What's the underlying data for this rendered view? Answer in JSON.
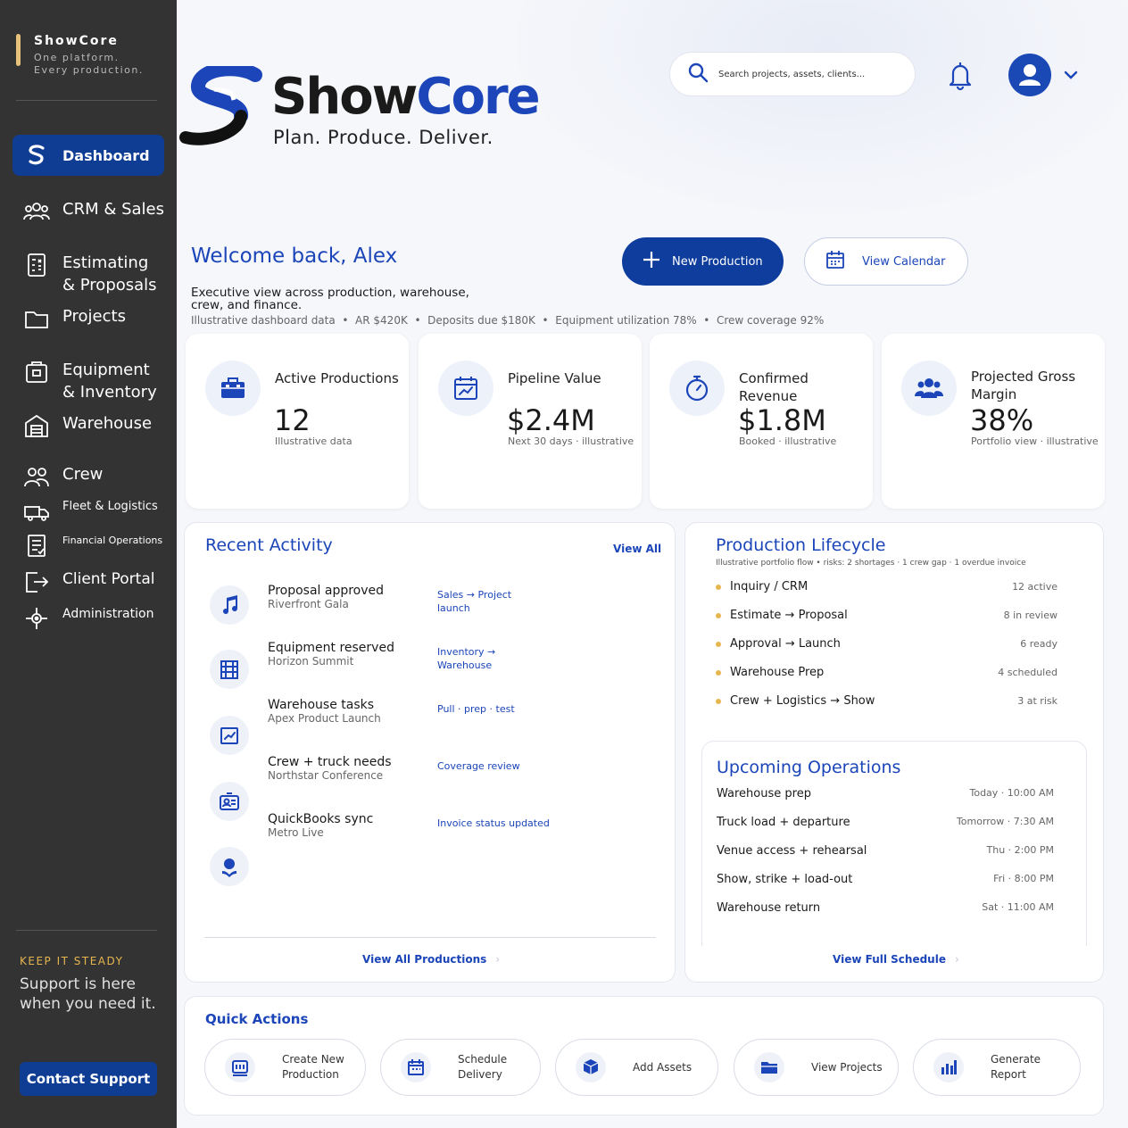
{
  "sidebar": {
    "brand_name": "ShowCore",
    "brand_tagline": "One platform. Every production.",
    "items": [
      {
        "label": "Dashboard",
        "icon": "showcore-logo-icon"
      },
      {
        "label": "CRM & Sales",
        "icon": "people-icon"
      },
      {
        "label": "Estimating & Proposals",
        "icon": "calculator-icon"
      },
      {
        "label": "Projects",
        "icon": "folder-icon"
      },
      {
        "label": "Equipment & Inventory",
        "icon": "case-icon"
      },
      {
        "label": "Warehouse",
        "icon": "warehouse-icon"
      },
      {
        "label": "Crew",
        "icon": "crew-icon"
      },
      {
        "label": "Fleet & Logistics",
        "icon": "truck-icon"
      },
      {
        "label": "Financial Operations",
        "icon": "invoice-icon"
      },
      {
        "label": "Client Portal",
        "icon": "portal-exit-icon"
      },
      {
        "label": "Administration",
        "icon": "admin-target-icon"
      }
    ],
    "keep_title": "KEEP IT STEADY",
    "keep_text": "Support is here when you need it.",
    "support_button": "Contact Support"
  },
  "header": {
    "logo_word_1": "Show",
    "logo_word_2": "Core",
    "logo_tagline": "Plan. Produce. Deliver.",
    "search_placeholder": "Search projects, assets, clients...",
    "welcome": "Welcome back, Alex",
    "subtitle": "Executive view across production, warehouse, crew, and finance.",
    "stats_line": "Illustrative dashboard data  •  AR $420K  •  Deposits due $180K  •  Equipment utilization 78%  •  Crew coverage 92%",
    "new_production": "New Production",
    "view_calendar": "View Calendar"
  },
  "kpis": [
    {
      "title": "Active Productions",
      "value": "12",
      "note": "Illustrative data",
      "icon": "production-case-icon"
    },
    {
      "title": "Pipeline Value",
      "value": "$2.4M",
      "note": "Next 30 days · illustrative",
      "icon": "calendar-chart-icon"
    },
    {
      "title": "Confirmed Revenue",
      "value": "$1.8M",
      "note": "Booked · illustrative",
      "icon": "stopwatch-icon"
    },
    {
      "title": "Projected Gross Margin",
      "value": "38%",
      "note": "Portfolio view · illustrative",
      "icon": "group-icon"
    }
  ],
  "activity": {
    "title": "Recent Activity",
    "view_all": "View All",
    "items": [
      {
        "title": "Proposal approved",
        "sub": "Riverfront Gala",
        "link": "Sales → Project launch"
      },
      {
        "title": "Equipment reserved",
        "sub": "Horizon Summit",
        "link": "Inventory → Warehouse"
      },
      {
        "title": "Warehouse tasks",
        "sub": "Apex Product Launch",
        "link": "Pull · prep · test"
      },
      {
        "title": "Crew + truck needs",
        "sub": "Northstar Conference",
        "link": "Coverage review"
      },
      {
        "title": "QuickBooks sync",
        "sub": "Metro Live",
        "link": "Invoice status updated"
      }
    ],
    "footer": "View All Productions"
  },
  "lifecycle": {
    "title": "Production Lifecycle",
    "subtitle": "Illustrative portfolio flow • risks: 2 shortages · 1 crew gap · 1 overdue invoice",
    "stages": [
      {
        "name": "Inquiry / CRM",
        "count": "12 active"
      },
      {
        "name": "Estimate → Proposal",
        "count": "8 in review"
      },
      {
        "name": "Approval → Launch",
        "count": "6 ready"
      },
      {
        "name": "Warehouse Prep",
        "count": "4 scheduled"
      },
      {
        "name": "Crew + Logistics → Show",
        "count": "3 at risk"
      }
    ]
  },
  "upcoming": {
    "title": "Upcoming Operations",
    "items": [
      {
        "name": "Warehouse prep",
        "time": "Today · 10:00 AM"
      },
      {
        "name": "Truck load + departure",
        "time": "Tomorrow · 7:30 AM"
      },
      {
        "name": "Venue access + rehearsal",
        "time": "Thu · 2:00 PM"
      },
      {
        "name": "Show, strike + load-out",
        "time": "Fri · 8:00 PM"
      },
      {
        "name": "Warehouse return",
        "time": "Sat · 11:00 AM"
      }
    ],
    "footer": "View Full Schedule"
  },
  "quick_actions": {
    "title": "Quick Actions",
    "items": [
      {
        "label": "Create New Production",
        "icon": "stage-icon"
      },
      {
        "label": "Schedule Delivery",
        "icon": "calendar-icon"
      },
      {
        "label": "Add Assets",
        "icon": "boxes-icon"
      },
      {
        "label": "View Projects",
        "icon": "folder-icon"
      },
      {
        "label": "Generate Report",
        "icon": "bar-report-icon"
      }
    ]
  },
  "colors": {
    "primary": "#0f3d9e",
    "accent": "#1b45b8",
    "gold": "#e6b64f",
    "sidebar": "#333334"
  }
}
